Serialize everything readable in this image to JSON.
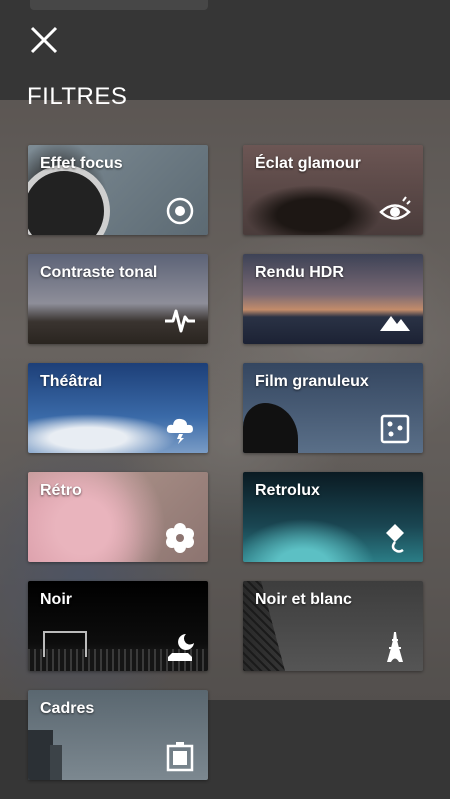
{
  "header": {
    "title": "FILTRES",
    "close_icon": "close-icon"
  },
  "filters": [
    {
      "label": "Effet focus",
      "icon": "focus-target-icon"
    },
    {
      "label": "Éclat glamour",
      "icon": "eye-icon"
    },
    {
      "label": "Contraste tonal",
      "icon": "pulse-icon"
    },
    {
      "label": "Rendu HDR",
      "icon": "mountains-icon"
    },
    {
      "label": "Théâtral",
      "icon": "storm-cloud-icon"
    },
    {
      "label": "Film granuleux",
      "icon": "dice-icon"
    },
    {
      "label": "Rétro",
      "icon": "flower-icon"
    },
    {
      "label": "Retrolux",
      "icon": "kite-icon"
    },
    {
      "label": "Noir",
      "icon": "night-moon-icon"
    },
    {
      "label": "Noir et blanc",
      "icon": "eiffel-tower-icon"
    },
    {
      "label": "Cadres",
      "icon": "frame-icon"
    }
  ]
}
